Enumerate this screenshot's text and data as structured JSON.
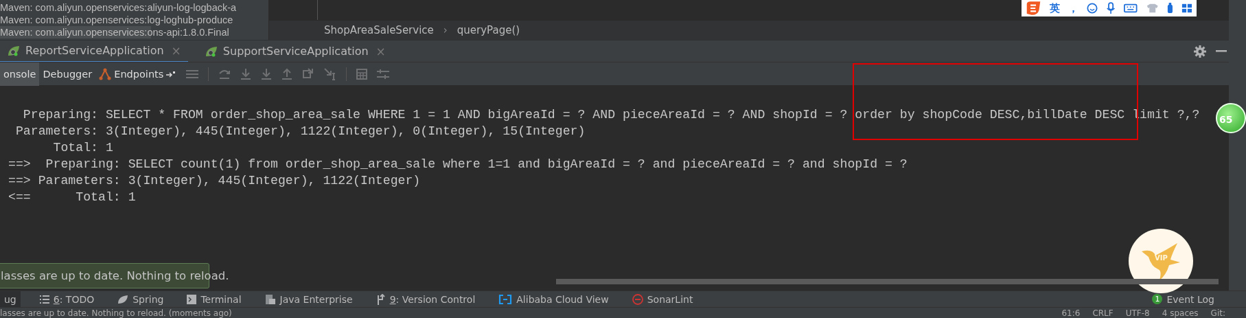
{
  "project_tree": {
    "items": [
      {
        "label": "Maven: com.aliyun.openservices:aliyun-log-logback-a",
        "selected": false
      },
      {
        "label": "Maven: com.aliyun.openservices:log-loghub-produce",
        "selected": false
      },
      {
        "label": "Maven: com.aliyun.openservices:ons-api:1.8.0.Final",
        "selected": true
      }
    ]
  },
  "ime_toolbar": {
    "language": "英",
    "punctuation": "，"
  },
  "breadcrumb": {
    "items": [
      "ShopAreaSaleService",
      "queryPage()"
    ],
    "separator": "›"
  },
  "run_tabs": [
    {
      "label": "ReportServiceApplication",
      "selected": true,
      "close": "×"
    },
    {
      "label": "SupportServiceApplication",
      "selected": false,
      "close": "×"
    }
  ],
  "debug_tabs": [
    {
      "label": "onsole",
      "selected": true,
      "kind": "plain"
    },
    {
      "label": "Debugger",
      "selected": false,
      "kind": "plain"
    },
    {
      "label": "Endpoints",
      "selected": false,
      "kind": "endpoints"
    }
  ],
  "console_lines": [
    "  Preparing: SELECT * FROM order_shop_area_sale WHERE 1 = 1 AND bigAreaId = ? AND pieceAreaId = ? AND shopId = ? order by shopCode DESC,billDate DESC limit ?,?",
    " Parameters: 3(Integer), 445(Integer), 1122(Integer), 0(Integer), 15(Integer)",
    "      Total: 1",
    "==>  Preparing: SELECT count(1) from order_shop_area_sale where 1=1 and bigAreaId = ? and pieceAreaId = ? and shopId = ?",
    "==> Parameters: 3(Integer), 445(Integer), 1122(Integer)",
    "<==      Total: 1"
  ],
  "notification": "lasses are up to date. Nothing to reload.",
  "side_badge": "65",
  "vip_widget": {
    "label": "VIP"
  },
  "tool_windows": [
    {
      "kind": "none",
      "label": "ug",
      "selected": true
    },
    {
      "kind": "list",
      "mnemonic": "6",
      "label": ": TODO",
      "selected": false
    },
    {
      "kind": "leaf",
      "label": "Spring",
      "selected": false
    },
    {
      "kind": "terminal",
      "label": "Terminal",
      "selected": false
    },
    {
      "kind": "javaee",
      "label": "Java Enterprise",
      "selected": false
    },
    {
      "kind": "vcs",
      "mnemonic": "9",
      "label": ": Version Control",
      "selected": false
    },
    {
      "kind": "cloud",
      "label": "Alibaba Cloud View",
      "selected": false
    },
    {
      "kind": "sonar",
      "label": "SonarLint",
      "selected": false
    }
  ],
  "event_log": {
    "count": "1",
    "label": "Event Log"
  },
  "status_bar": {
    "message": "lasses are up to date. Nothing to reload. (moments ago)",
    "items": [
      "61:6",
      "CRLF",
      "UTF-8",
      "4 spaces",
      "Git:"
    ]
  }
}
